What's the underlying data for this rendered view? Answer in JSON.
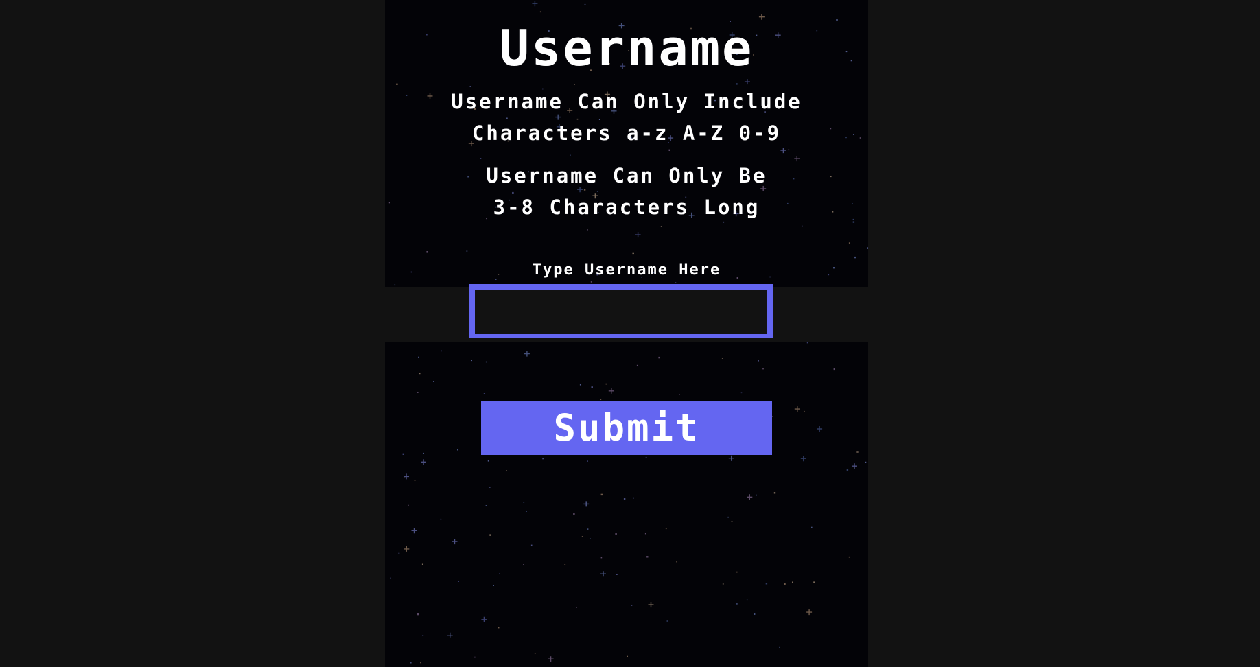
{
  "screen": {
    "title": "Username",
    "rules": {
      "characters_line1": "Username Can Only Include",
      "characters_line2": "Characters a-z A-Z 0-9",
      "length_line1": "Username Can Only Be",
      "length_line2": "3-8 Characters Long"
    },
    "input": {
      "label": "Type Username Here",
      "value": "",
      "placeholder": ""
    },
    "submit_label": "Submit"
  },
  "colors": {
    "page_background": "#121212",
    "stage_background": "#030307",
    "accent": "#6466f1",
    "text": "#ffffff"
  },
  "icons": {
    "background": "starfield"
  }
}
